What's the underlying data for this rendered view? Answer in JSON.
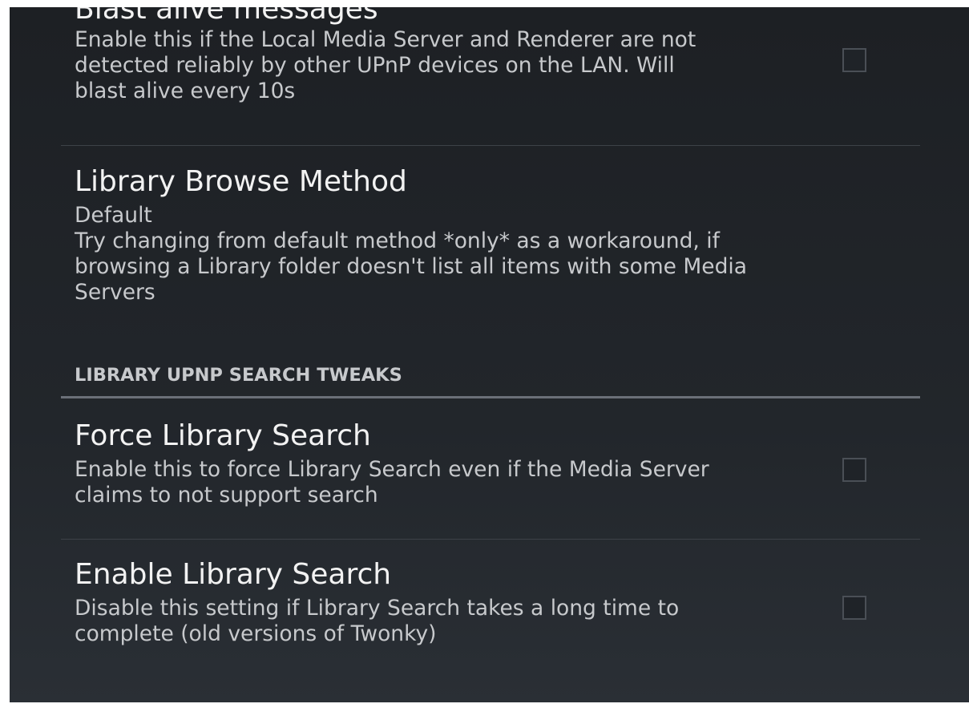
{
  "preferences": {
    "blast_alive": {
      "title": "Blast alive messages",
      "summary_lines": [
        "Enable this if the Local Media Server and Renderer are not",
        "detected reliably by other UPnP devices on the LAN. Will",
        "blast alive every 10s"
      ],
      "checked": false
    },
    "browse_method": {
      "title": "Library Browse Method",
      "value": "Default",
      "summary_lines": [
        "Try changing from default method *only* as a workaround, if",
        "browsing a Library folder doesn't list all items with some Media",
        "Servers"
      ]
    },
    "category": {
      "label": "LIBRARY UPNP SEARCH TWEAKS"
    },
    "force_search": {
      "title": "Force Library Search",
      "summary_lines": [
        "Enable this to force Library Search even if the Media Server",
        "claims to not support search"
      ],
      "checked": false
    },
    "enable_search": {
      "title": "Enable Library Search",
      "summary_lines": [
        "Disable this setting if Library Search takes a long time to",
        "complete (old versions of Twonky)"
      ],
      "checked": false
    }
  }
}
